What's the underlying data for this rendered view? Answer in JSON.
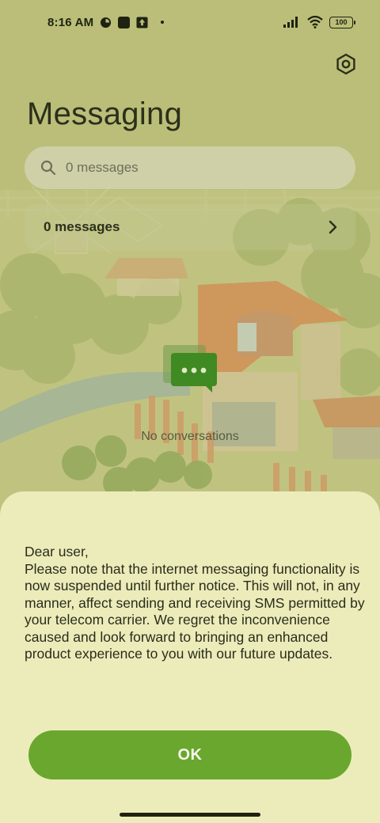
{
  "status_bar": {
    "time": "8:16 AM",
    "battery": "100"
  },
  "app": {
    "title": "Messaging",
    "search": {
      "placeholder": "0 messages"
    },
    "messages_row": {
      "label": "0 messages"
    },
    "empty_state": {
      "text": "No conversations"
    }
  },
  "dialog": {
    "body": "Dear user,\nPlease note that the internet messaging functionality is now suspended until further notice. This will not, in any manner, affect sending and receiving SMS permitted by your telecom carrier. We regret the inconvenience caused and look forward to bringing an enhanced product experience to you with our future updates.",
    "ok_label": "OK"
  },
  "colors": {
    "accent": "#6aa72e",
    "sheet_background": "#ececbb",
    "bubble_green": "#3f8a22"
  },
  "icons": [
    "status-app-icon",
    "status-square-icon",
    "status-upload-icon",
    "signal-icon",
    "wifi-icon",
    "battery-icon",
    "settings-gear-icon",
    "search-icon",
    "chevron-right-icon",
    "chat-bubble-icon"
  ]
}
